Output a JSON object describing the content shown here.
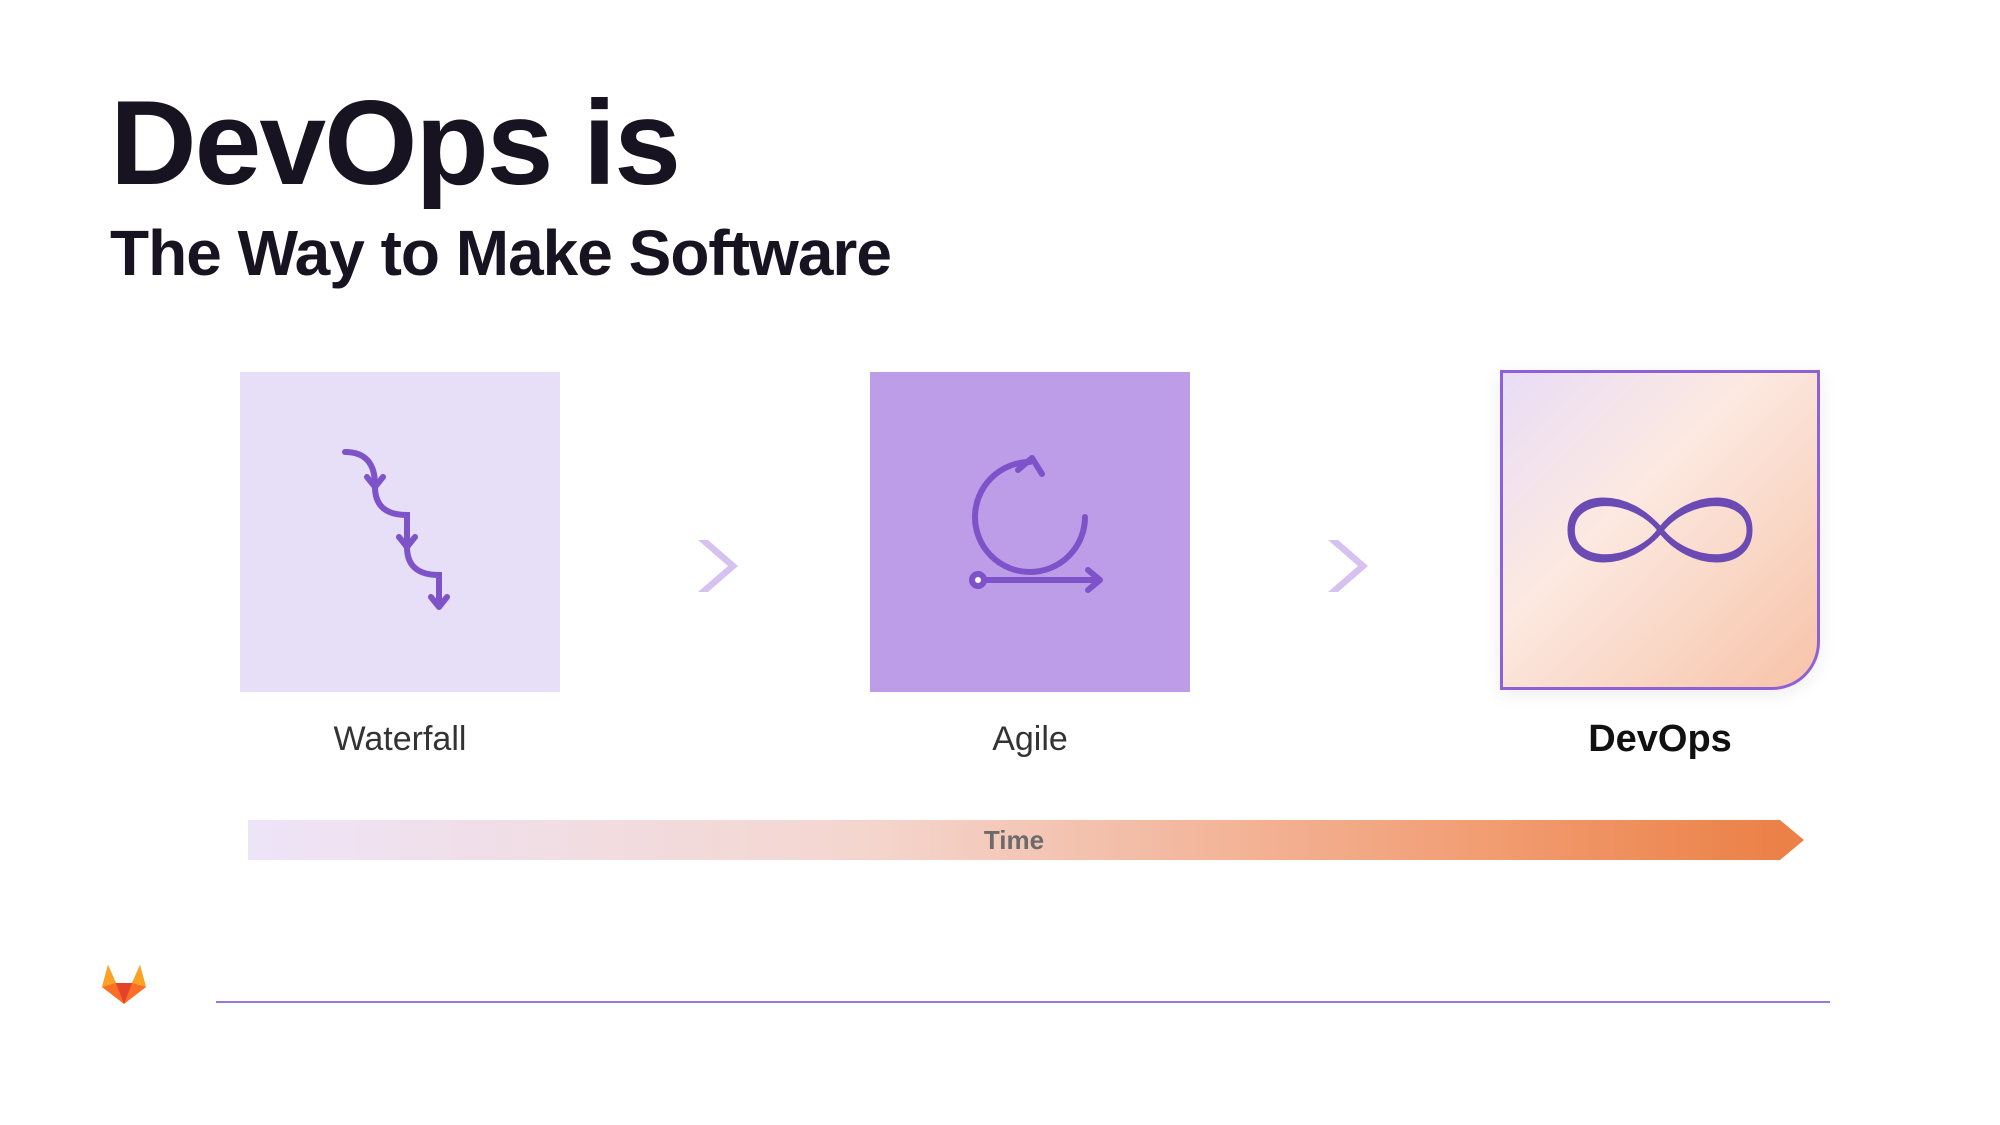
{
  "title": "DevOps is",
  "subtitle": "The Way to Make Software",
  "stages": {
    "waterfall": "Waterfall",
    "agile": "Agile",
    "devops": "DevOps"
  },
  "timeline_label": "Time",
  "colors": {
    "purple_light": "#E7DEF7",
    "purple_mid": "#BD9CE8",
    "purple_stroke": "#7E53C9",
    "brand_orange": "#FC6D26"
  }
}
